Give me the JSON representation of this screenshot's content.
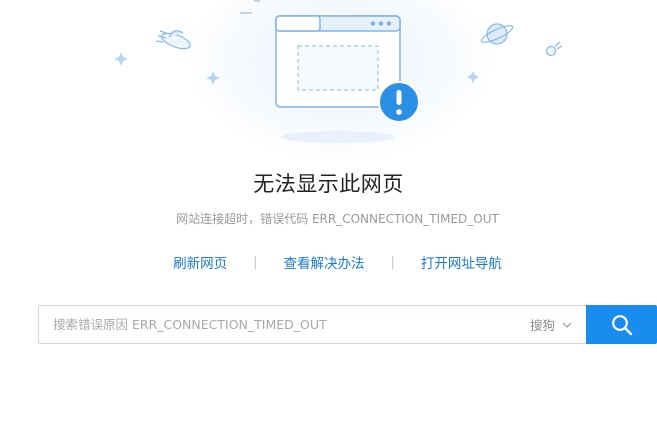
{
  "error": {
    "title": "无法显示此网页",
    "subtitle": "网站连接超时，错误代码 ERR_CONNECTION_TIMED_OUT"
  },
  "actions": [
    {
      "label": "刷新网页"
    },
    {
      "label": "查看解决办法"
    },
    {
      "label": "打开网址导航"
    }
  ],
  "separator": "|",
  "search": {
    "placeholder": "搜索错误原因 ERR_CONNECTION_TIMED_OUT",
    "engine": "搜狗",
    "button_icon": "search-icon"
  },
  "colors": {
    "link": "#1a7ad4",
    "search_button": "#1a8cf0",
    "illustration_blue": "#2b8fe6"
  }
}
